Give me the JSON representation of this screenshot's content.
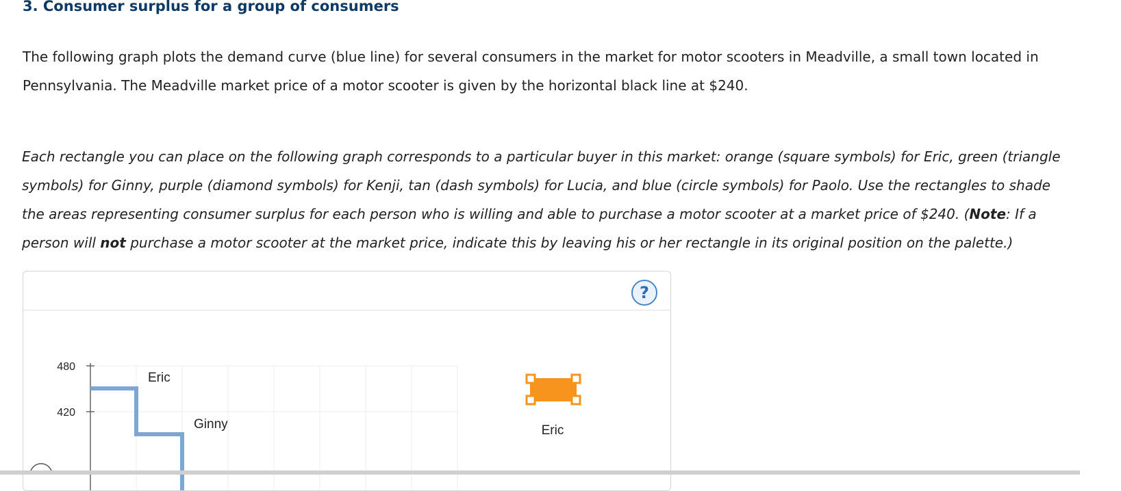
{
  "question": {
    "heading": "3. Consumer surplus for a group of consumers",
    "intro_line1": "The following graph plots the demand curve (blue line) for several consumers in the market for motor scooters in Meadville, a small town located in",
    "intro_line2": "Pennsylvania. The Meadville market price of a motor scooter is given by the horizontal black line at $240.",
    "instr_line1": "Each rectangle you can place on the following graph corresponds to a particular buyer in this market: orange (square symbols) for Eric, green (triangle",
    "instr_line2": "symbols) for Ginny, purple (diamond symbols) for Kenji, tan (dash symbols) for Lucia, and blue (circle symbols) for Paolo. Use the rectangles to shade",
    "instr_line3_pre": "the areas representing consumer surplus for each person who is willing and able to purchase a motor scooter at a market price of $240. (",
    "instr_note": "Note",
    "instr_line3_post": ": If a",
    "instr_line4_pre": "person will ",
    "instr_not": "not",
    "instr_line4_post": " purchase a motor scooter at the market price, indicate this by leaving his or her rectangle in its original position on the palette.)"
  },
  "widget": {
    "help_label": "?",
    "y_ticks": [
      "480",
      "420"
    ],
    "curve_labels": [
      "Eric",
      "Ginny"
    ],
    "palette": [
      {
        "name": "Eric",
        "color": "#f7941d",
        "symbol": "square"
      }
    ]
  },
  "colors": {
    "demand_curve": "#7ea6d3",
    "heading": "#0f3a63",
    "grid": "#ececec"
  }
}
